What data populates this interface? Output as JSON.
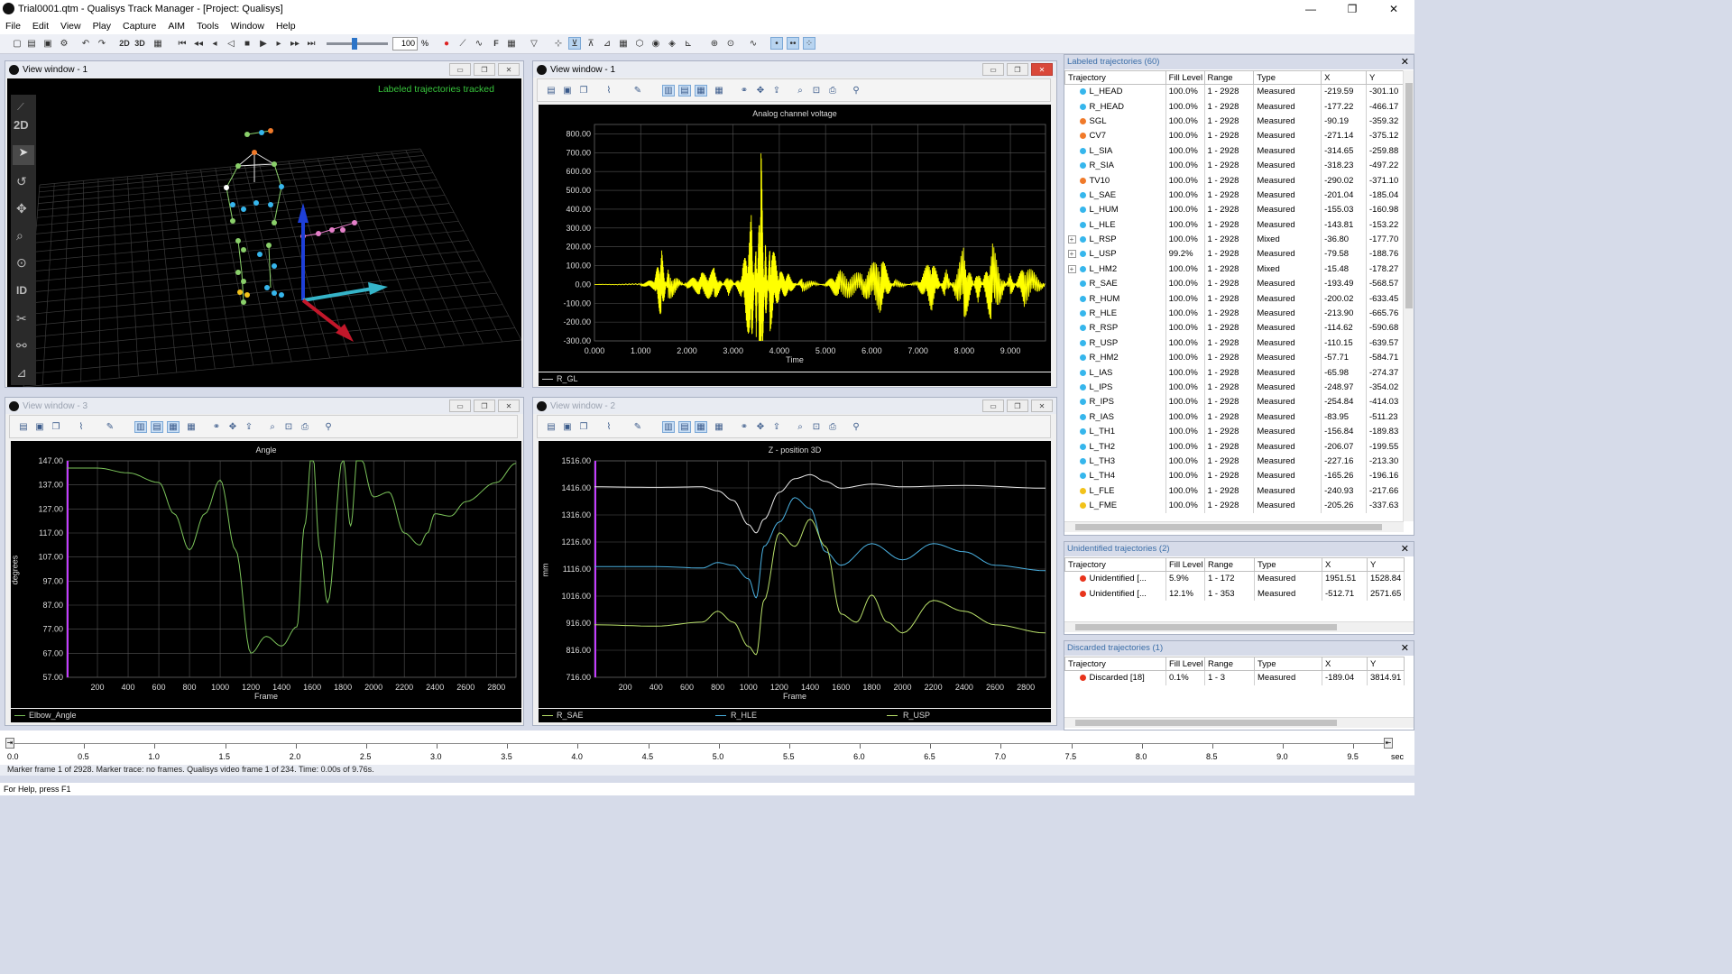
{
  "window": {
    "title": "Trial0001.qtm - Qualisys Track Manager - [Project: Qualisys]",
    "minimize": "—",
    "maximize": "❐",
    "close": "✕"
  },
  "menu": [
    "File",
    "Edit",
    "View",
    "Play",
    "Capture",
    "AIM",
    "Tools",
    "Window",
    "Help"
  ],
  "toolbar": {
    "speed_value": "100",
    "speed_unit": "%",
    "label_2d": "2D",
    "label_3d": "3D",
    "label_f": "F"
  },
  "view1": {
    "title": "View window - 1",
    "status_text": "Labeled trajectories tracked",
    "side_tools": {
      "label_2d": "2D",
      "label_id": "ID"
    }
  },
  "analog": {
    "title": "View window - 1",
    "chart_title": "Analog channel voltage",
    "xlabel": "Time",
    "legend": "R_GL"
  },
  "angle": {
    "title": "View window - 3",
    "chart_title": "Angle",
    "xlabel": "Frame",
    "ylabel": "degrees",
    "legend": "Elbow_Angle"
  },
  "zpos": {
    "title": "View window - 2",
    "chart_title": "Z - position 3D",
    "xlabel": "Frame",
    "ylabel": "mm",
    "legend": [
      "R_SAE",
      "R_HLE",
      "R_USP"
    ]
  },
  "chart_data": [
    {
      "type": "line",
      "title": "Analog channel voltage",
      "xlabel": "Time",
      "ylabel": "",
      "xlim": [
        0.0,
        9.76
      ],
      "ylim": [
        -300.0,
        850.0
      ],
      "xticks": [
        "0.000",
        "1.000",
        "2.000",
        "3.000",
        "4.000",
        "5.000",
        "6.000",
        "7.000",
        "8.000",
        "9.000"
      ],
      "yticks": [
        "800.00",
        "700.00",
        "600.00",
        "500.00",
        "400.00",
        "300.00",
        "200.00",
        "100.00",
        "0.00",
        "-100.00",
        "-200.00",
        "-300.00"
      ],
      "series": [
        {
          "name": "R_GL",
          "color": "#ffff00",
          "x": [
            0.0,
            1.0,
            1.3,
            1.45,
            1.6,
            2.0,
            2.3,
            2.6,
            2.9,
            3.2,
            3.4,
            3.5,
            3.6,
            3.7,
            3.8,
            4.0,
            4.2,
            4.5,
            5.0,
            5.3,
            5.8,
            6.2,
            6.5,
            7.0,
            7.3,
            7.6,
            8.0,
            8.3,
            8.6,
            9.0,
            9.3,
            9.76
          ],
          "y": [
            0,
            5,
            30,
            190,
            -90,
            20,
            60,
            90,
            -60,
            80,
            380,
            -280,
            790,
            -250,
            250,
            70,
            60,
            -40,
            10,
            80,
            60,
            160,
            -30,
            20,
            150,
            -90,
            210,
            -100,
            230,
            -70,
            120,
            5
          ]
        }
      ]
    },
    {
      "type": "line",
      "title": "Angle",
      "xlabel": "Frame",
      "ylabel": "degrees",
      "xlim": [
        0,
        2928
      ],
      "ylim": [
        57.0,
        147.0
      ],
      "xticks": [
        "200",
        "400",
        "600",
        "800",
        "1000",
        "1200",
        "1400",
        "1600",
        "1800",
        "2000",
        "2200",
        "2400",
        "2600",
        "2800"
      ],
      "yticks": [
        "147.00",
        "137.00",
        "127.00",
        "117.00",
        "107.00",
        "97.00",
        "87.00",
        "77.00",
        "67.00",
        "57.00"
      ],
      "series": [
        {
          "name": "Elbow_Angle",
          "color": "#7bc35a",
          "x": [
            0,
            200,
            400,
            600,
            700,
            800,
            900,
            1000,
            1100,
            1200,
            1300,
            1400,
            1500,
            1550,
            1600,
            1650,
            1700,
            1800,
            1850,
            1900,
            2000,
            2100,
            2200,
            2300,
            2350,
            2400,
            2500,
            2600,
            2800,
            2928
          ],
          "y": [
            144,
            144,
            142,
            138,
            125,
            110,
            125,
            139,
            110,
            67,
            74,
            70,
            78,
            120,
            152,
            110,
            88,
            148,
            120,
            152,
            132,
            134,
            117,
            112,
            117,
            125,
            124,
            130,
            138,
            146
          ]
        }
      ]
    },
    {
      "type": "line",
      "title": "Z - position 3D",
      "xlabel": "Frame",
      "ylabel": "mm",
      "xlim": [
        0,
        2928
      ],
      "ylim": [
        716.0,
        1516.0
      ],
      "xticks": [
        "200",
        "400",
        "600",
        "800",
        "1000",
        "1200",
        "1400",
        "1600",
        "1800",
        "2000",
        "2200",
        "2400",
        "2600",
        "2800"
      ],
      "yticks": [
        "1516.00",
        "1416.00",
        "1316.00",
        "1216.00",
        "1116.00",
        "1016.00",
        "916.00",
        "816.00",
        "716.00"
      ],
      "series": [
        {
          "name": "R_SAE",
          "color": "#e8e8e8",
          "x": [
            0,
            400,
            700,
            800,
            900,
            1000,
            1050,
            1100,
            1200,
            1300,
            1400,
            1500,
            1600,
            1800,
            2000,
            2400,
            2928
          ],
          "y": [
            1420,
            1418,
            1420,
            1405,
            1370,
            1280,
            1250,
            1300,
            1400,
            1450,
            1465,
            1440,
            1415,
            1430,
            1420,
            1425,
            1415
          ]
        },
        {
          "name": "R_HLE",
          "color": "#4ab0e0",
          "x": [
            0,
            400,
            700,
            800,
            900,
            1000,
            1050,
            1100,
            1200,
            1300,
            1400,
            1500,
            1600,
            1800,
            2000,
            2200,
            2400,
            2600,
            2928
          ],
          "y": [
            1125,
            1125,
            1120,
            1140,
            1130,
            1080,
            1010,
            1200,
            1290,
            1380,
            1340,
            1180,
            1130,
            1210,
            1150,
            1210,
            1180,
            1130,
            1110
          ]
        },
        {
          "name": "R_USP",
          "color": "#b9e06a",
          "x": [
            0,
            400,
            700,
            800,
            900,
            1000,
            1050,
            1100,
            1200,
            1300,
            1400,
            1500,
            1600,
            1700,
            1800,
            1900,
            2000,
            2200,
            2400,
            2600,
            2928
          ],
          "y": [
            910,
            905,
            920,
            960,
            920,
            830,
            800,
            1000,
            1250,
            1200,
            1300,
            1200,
            950,
            920,
            1020,
            920,
            880,
            1000,
            960,
            910,
            880
          ]
        }
      ]
    }
  ],
  "labeled": {
    "title": "Labeled trajectories (60)",
    "close": "✕",
    "columns": [
      "Trajectory",
      "Fill Level",
      "Range",
      "Type",
      "X",
      "Y"
    ],
    "rows": [
      {
        "exp": "",
        "color": "#36b6ec",
        "name": "L_HEAD",
        "fill": "100.0%",
        "range": "1 - 2928",
        "type": "Measured",
        "x": "-219.59",
        "y": "-301.10"
      },
      {
        "exp": "",
        "color": "#36b6ec",
        "name": "R_HEAD",
        "fill": "100.0%",
        "range": "1 - 2928",
        "type": "Measured",
        "x": "-177.22",
        "y": "-466.17"
      },
      {
        "exp": "",
        "color": "#f07a2a",
        "name": "SGL",
        "fill": "100.0%",
        "range": "1 - 2928",
        "type": "Measured",
        "x": "-90.19",
        "y": "-359.32"
      },
      {
        "exp": "",
        "color": "#f07a2a",
        "name": "CV7",
        "fill": "100.0%",
        "range": "1 - 2928",
        "type": "Measured",
        "x": "-271.14",
        "y": "-375.12"
      },
      {
        "exp": "",
        "color": "#36b6ec",
        "name": "L_SIA",
        "fill": "100.0%",
        "range": "1 - 2928",
        "type": "Measured",
        "x": "-314.65",
        "y": "-259.88"
      },
      {
        "exp": "",
        "color": "#36b6ec",
        "name": "R_SIA",
        "fill": "100.0%",
        "range": "1 - 2928",
        "type": "Measured",
        "x": "-318.23",
        "y": "-497.22"
      },
      {
        "exp": "",
        "color": "#f07a2a",
        "name": "TV10",
        "fill": "100.0%",
        "range": "1 - 2928",
        "type": "Measured",
        "x": "-290.02",
        "y": "-371.10"
      },
      {
        "exp": "",
        "color": "#36b6ec",
        "name": "L_SAE",
        "fill": "100.0%",
        "range": "1 - 2928",
        "type": "Measured",
        "x": "-201.04",
        "y": "-185.04"
      },
      {
        "exp": "",
        "color": "#36b6ec",
        "name": "L_HUM",
        "fill": "100.0%",
        "range": "1 - 2928",
        "type": "Measured",
        "x": "-155.03",
        "y": "-160.98"
      },
      {
        "exp": "",
        "color": "#36b6ec",
        "name": "L_HLE",
        "fill": "100.0%",
        "range": "1 - 2928",
        "type": "Measured",
        "x": "-143.81",
        "y": "-153.22"
      },
      {
        "exp": "+",
        "color": "#36b6ec",
        "name": "L_RSP",
        "fill": "100.0%",
        "range": "1 - 2928",
        "type": "Mixed",
        "x": "-36.80",
        "y": "-177.70"
      },
      {
        "exp": "+",
        "color": "#36b6ec",
        "name": "L_USP",
        "fill": "99.2%",
        "range": "1 - 2928",
        "type": "Measured",
        "x": "-79.58",
        "y": "-188.76"
      },
      {
        "exp": "+",
        "color": "#36b6ec",
        "name": "L_HM2",
        "fill": "100.0%",
        "range": "1 - 2928",
        "type": "Mixed",
        "x": "-15.48",
        "y": "-178.27"
      },
      {
        "exp": "",
        "color": "#36b6ec",
        "name": "R_SAE",
        "fill": "100.0%",
        "range": "1 - 2928",
        "type": "Measured",
        "x": "-193.49",
        "y": "-568.57"
      },
      {
        "exp": "",
        "color": "#36b6ec",
        "name": "R_HUM",
        "fill": "100.0%",
        "range": "1 - 2928",
        "type": "Measured",
        "x": "-200.02",
        "y": "-633.45"
      },
      {
        "exp": "",
        "color": "#36b6ec",
        "name": "R_HLE",
        "fill": "100.0%",
        "range": "1 - 2928",
        "type": "Measured",
        "x": "-213.90",
        "y": "-665.76"
      },
      {
        "exp": "",
        "color": "#36b6ec",
        "name": "R_RSP",
        "fill": "100.0%",
        "range": "1 - 2928",
        "type": "Measured",
        "x": "-114.62",
        "y": "-590.68"
      },
      {
        "exp": "",
        "color": "#36b6ec",
        "name": "R_USP",
        "fill": "100.0%",
        "range": "1 - 2928",
        "type": "Measured",
        "x": "-110.15",
        "y": "-639.57"
      },
      {
        "exp": "",
        "color": "#36b6ec",
        "name": "R_HM2",
        "fill": "100.0%",
        "range": "1 - 2928",
        "type": "Measured",
        "x": "-57.71",
        "y": "-584.71"
      },
      {
        "exp": "",
        "color": "#36b6ec",
        "name": "L_IAS",
        "fill": "100.0%",
        "range": "1 - 2928",
        "type": "Measured",
        "x": "-65.98",
        "y": "-274.37"
      },
      {
        "exp": "",
        "color": "#36b6ec",
        "name": "L_IPS",
        "fill": "100.0%",
        "range": "1 - 2928",
        "type": "Measured",
        "x": "-248.97",
        "y": "-354.02"
      },
      {
        "exp": "",
        "color": "#36b6ec",
        "name": "R_IPS",
        "fill": "100.0%",
        "range": "1 - 2928",
        "type": "Measured",
        "x": "-254.84",
        "y": "-414.03"
      },
      {
        "exp": "",
        "color": "#36b6ec",
        "name": "R_IAS",
        "fill": "100.0%",
        "range": "1 - 2928",
        "type": "Measured",
        "x": "-83.95",
        "y": "-511.23"
      },
      {
        "exp": "",
        "color": "#36b6ec",
        "name": "L_TH1",
        "fill": "100.0%",
        "range": "1 - 2928",
        "type": "Measured",
        "x": "-156.84",
        "y": "-189.83"
      },
      {
        "exp": "",
        "color": "#36b6ec",
        "name": "L_TH2",
        "fill": "100.0%",
        "range": "1 - 2928",
        "type": "Measured",
        "x": "-206.07",
        "y": "-199.55"
      },
      {
        "exp": "",
        "color": "#36b6ec",
        "name": "L_TH3",
        "fill": "100.0%",
        "range": "1 - 2928",
        "type": "Measured",
        "x": "-227.16",
        "y": "-213.30"
      },
      {
        "exp": "",
        "color": "#36b6ec",
        "name": "L_TH4",
        "fill": "100.0%",
        "range": "1 - 2928",
        "type": "Measured",
        "x": "-165.26",
        "y": "-196.16"
      },
      {
        "exp": "",
        "color": "#f2c21a",
        "name": "L_FLE",
        "fill": "100.0%",
        "range": "1 - 2928",
        "type": "Measured",
        "x": "-240.93",
        "y": "-217.66"
      },
      {
        "exp": "",
        "color": "#f2c21a",
        "name": "L_FME",
        "fill": "100.0%",
        "range": "1 - 2928",
        "type": "Measured",
        "x": "-205.26",
        "y": "-337.63"
      }
    ]
  },
  "unidentified": {
    "title": "Unidentified trajectories (2)",
    "close": "✕",
    "columns": [
      "Trajectory",
      "Fill Level",
      "Range",
      "Type",
      "X",
      "Y"
    ],
    "rows": [
      {
        "color": "#e8341c",
        "name": "Unidentified [...",
        "fill": "5.9%",
        "range": "1 - 172",
        "type": "Measured",
        "x": "1951.51",
        "y": "1528.84"
      },
      {
        "color": "#e8341c",
        "name": "Unidentified [...",
        "fill": "12.1%",
        "range": "1 - 353",
        "type": "Measured",
        "x": "-512.71",
        "y": "2571.65"
      }
    ]
  },
  "discarded": {
    "title": "Discarded trajectories (1)",
    "close": "✕",
    "columns": [
      "Trajectory",
      "Fill Level",
      "Range",
      "Type",
      "X",
      "Y"
    ],
    "rows": [
      {
        "color": "#e8341c",
        "name": "Discarded [18]",
        "fill": "0.1%",
        "range": "1 - 3",
        "type": "Measured",
        "x": "-189.04",
        "y": "3814.91"
      }
    ]
  },
  "timeline": {
    "ticks": [
      "0.0",
      "0.5",
      "1.0",
      "1.5",
      "2.0",
      "2.5",
      "3.0",
      "3.5",
      "4.0",
      "4.5",
      "5.0",
      "5.5",
      "6.0",
      "6.5",
      "7.0",
      "7.5",
      "8.0",
      "8.5",
      "9.0",
      "9.5"
    ],
    "unit": "sec",
    "status": "Marker frame 1 of 2928. Marker trace: no frames. Qualisys video frame 1 of 234. Time: 0.00s of 9.76s."
  },
  "statusbar": "For Help, press F1"
}
